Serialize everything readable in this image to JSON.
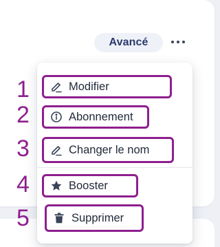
{
  "card": {
    "badge_label": "Avancé"
  },
  "menu": {
    "items": [
      {
        "label": "Modifier",
        "icon": "pencil-icon",
        "number": "1"
      },
      {
        "label": "Abonnement",
        "icon": "info-icon",
        "number": "2"
      },
      {
        "label": "Changer le nom",
        "icon": "pencil-icon",
        "number": "3"
      },
      {
        "label": "Booster",
        "icon": "star-icon",
        "number": "4"
      },
      {
        "label": "Supprimer",
        "icon": "trash-icon",
        "number": "5"
      }
    ]
  },
  "colors": {
    "annotation": "#8e1f8e",
    "badge_bg": "#eef1f8",
    "badge_text": "#2b3a6b",
    "menu_text": "#222a3a",
    "page_bg": "#eef0f5"
  }
}
